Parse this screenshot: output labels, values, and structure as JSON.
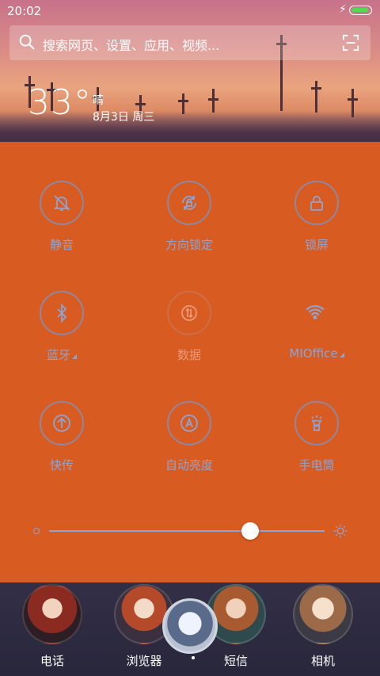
{
  "status_bar": {
    "time": "20:02",
    "battery_level": 1.0,
    "charging": true
  },
  "search": {
    "placeholder": "搜索网页、设置、应用、视频..."
  },
  "weather": {
    "temperature": "33°",
    "condition": "晴",
    "date": "8月3日 周三"
  },
  "quick_settings": {
    "toggles": [
      {
        "id": "mute",
        "label": "静音",
        "icon": "bell-off-icon",
        "state": "off"
      },
      {
        "id": "rotation-lock",
        "label": "方向锁定",
        "icon": "rotation-lock-icon",
        "state": "off"
      },
      {
        "id": "lock-screen",
        "label": "锁屏",
        "icon": "lock-icon",
        "state": "off"
      },
      {
        "id": "bluetooth",
        "label": "蓝牙",
        "icon": "bluetooth-icon",
        "state": "off",
        "expandable": true
      },
      {
        "id": "data",
        "label": "数据",
        "icon": "data-transfer-icon",
        "state": "disabled"
      },
      {
        "id": "wifi",
        "label": "MIOffice",
        "icon": "wifi-icon",
        "state": "on",
        "expandable": true
      },
      {
        "id": "quick-share",
        "label": "快传",
        "icon": "upload-arrow-icon",
        "state": "off"
      },
      {
        "id": "auto-brightness",
        "label": "自动亮度",
        "icon": "auto-brightness-icon",
        "state": "off"
      },
      {
        "id": "flashlight",
        "label": "手电筒",
        "icon": "flashlight-icon",
        "state": "off"
      }
    ],
    "brightness": 0.73
  },
  "dock": {
    "items": [
      {
        "label": "电话",
        "icon": "phone-app-icon"
      },
      {
        "label": "浏览器",
        "icon": "browser-app-icon"
      },
      {
        "label": "短信",
        "icon": "messages-app-icon"
      },
      {
        "label": "相机",
        "icon": "camera-app-icon"
      }
    ]
  },
  "colors": {
    "panel": "#d85c22",
    "toggle_outline": "#8ca4d4",
    "battery": "#4cdd55"
  }
}
